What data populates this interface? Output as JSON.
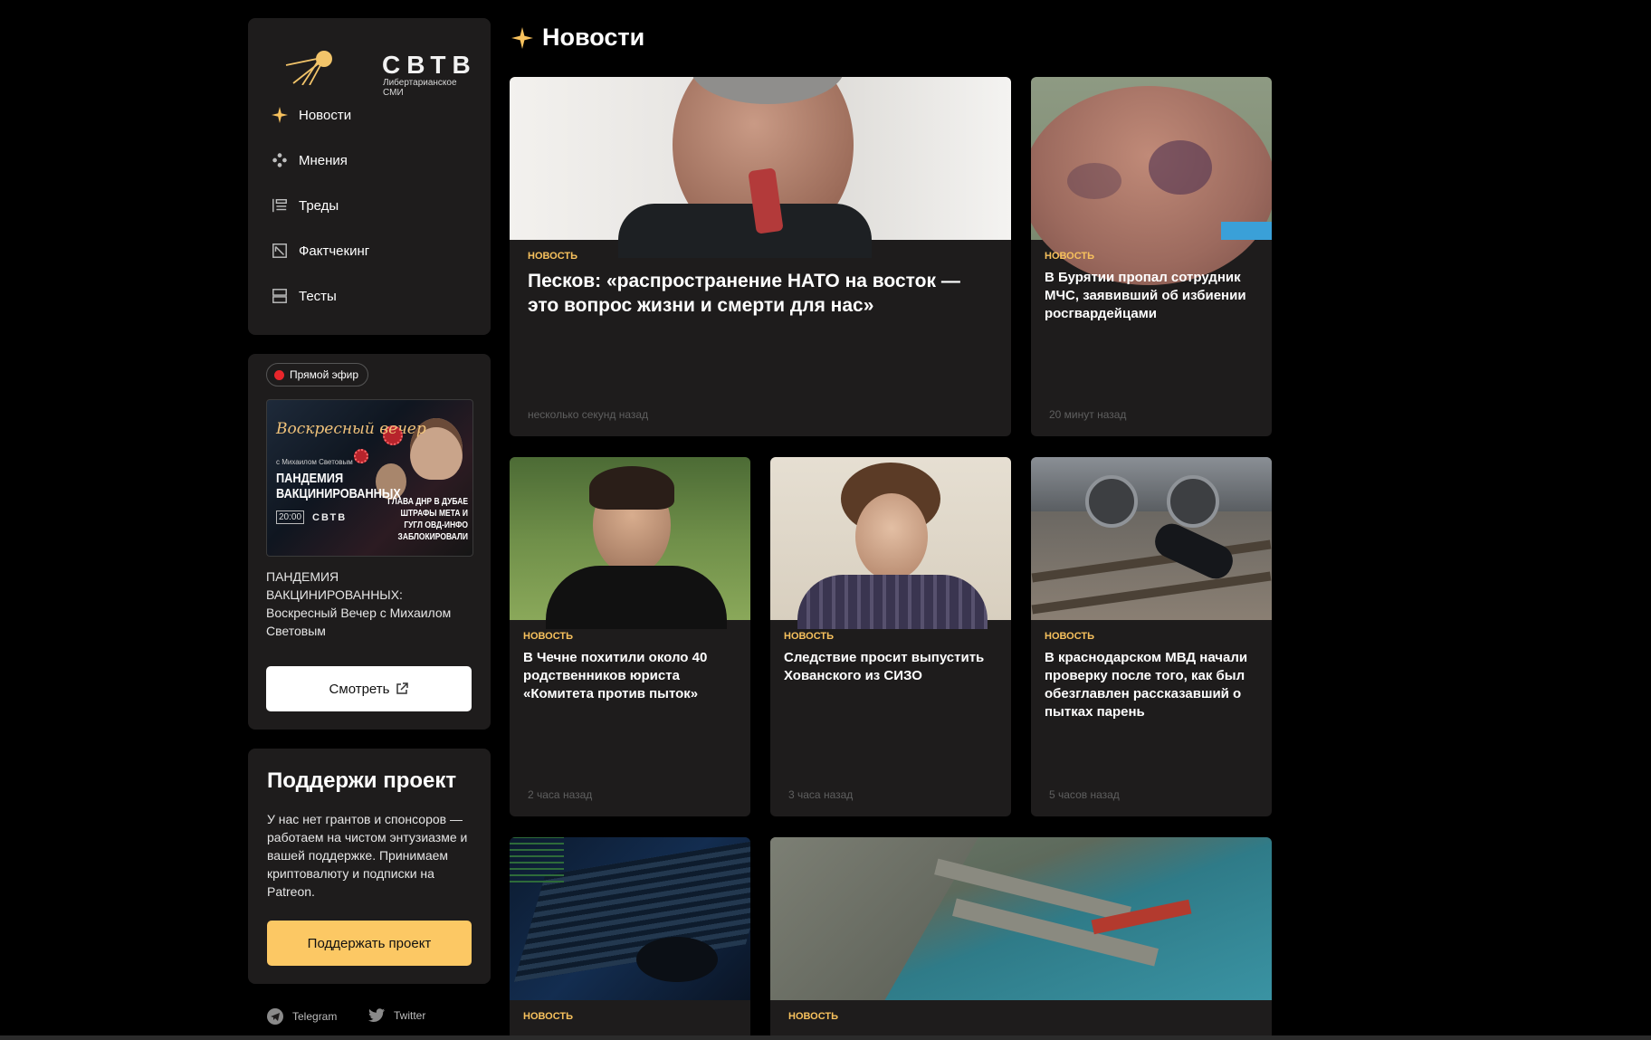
{
  "brand": {
    "name": "СВТВ",
    "tagline": "Либертарианское СМИ"
  },
  "nav": {
    "items": [
      {
        "label": "Новости",
        "icon": "sparkle-icon",
        "active": true
      },
      {
        "label": "Мнения",
        "icon": "dots-cluster-icon"
      },
      {
        "label": "Треды",
        "icon": "threads-icon"
      },
      {
        "label": "Фактчекинг",
        "icon": "factcheck-icon"
      },
      {
        "label": "Тесты",
        "icon": "tests-icon"
      }
    ]
  },
  "live": {
    "badge": "Прямой эфир",
    "thumb": {
      "script_title": "Воскресный вечер",
      "with": "с Михаилом Световым",
      "big": "ПАНДЕМИЯ ВАКЦИНИРОВАННЫХ",
      "time": "20:00",
      "logo": "СВТВ",
      "right": "ГЛАВА ДНР В ДУБАЕ ШТРАФЫ МЕТА И ГУГЛ ОВД-ИНФО ЗАБЛОКИРОВАЛИ"
    },
    "description": "ПАНДЕМИЯ ВАКЦИНИРОВАННЫХ: Воскресный Вечер с Михаилом Световым",
    "watch_label": "Смотреть"
  },
  "support": {
    "title": "Поддержи проект",
    "text": "У нас нет грантов и спонсоров — работаем на чистом энтузиазме и вашей поддержке. Принимаем криптовалюту и подписки на Patreon.",
    "button_label": "Поддержать проект"
  },
  "social": {
    "telegram": "Telegram",
    "twitter": "Twitter"
  },
  "page": {
    "title": "Новости"
  },
  "colors": {
    "accent": "#fcc864",
    "tag": "#f7c15d",
    "panel": "#1e1c1c",
    "background": "#000000",
    "live": "#e8262b"
  },
  "articles": [
    {
      "tag": "Новость",
      "title": "Песков: «распространение НАТО на восток — это вопрос жизни и смерти для нас»",
      "time": "несколько секунд назад",
      "image": "press-secretary-photo"
    },
    {
      "tag": "Новость",
      "title": "В Бурятии пропал сотрудник МЧС, заявивший об избиении росгвардейцами",
      "time": "20 минут назад",
      "image": "bruised-back-photo"
    },
    {
      "tag": "Новость",
      "title": "В Чечне похитили около 40 родственников юриста «Комитета против пыток»",
      "time": "2 часа назад",
      "image": "young-man-photo"
    },
    {
      "tag": "Новость",
      "title": "Следствие просит выпустить Хованского из СИЗО",
      "time": "3 часа назад",
      "image": "curly-man-photo"
    },
    {
      "tag": "Новость",
      "title": "В краснодарском МВД начали проверку после того, как был обезглавлен рассказавший о пытках парень",
      "time": "5 часов назад",
      "image": "railway-photo"
    },
    {
      "tag": "Новость",
      "title": "",
      "time": "",
      "image": "laptop-photo"
    },
    {
      "tag": "Новость",
      "title": "",
      "time": "",
      "image": "port-aerial-photo"
    }
  ]
}
